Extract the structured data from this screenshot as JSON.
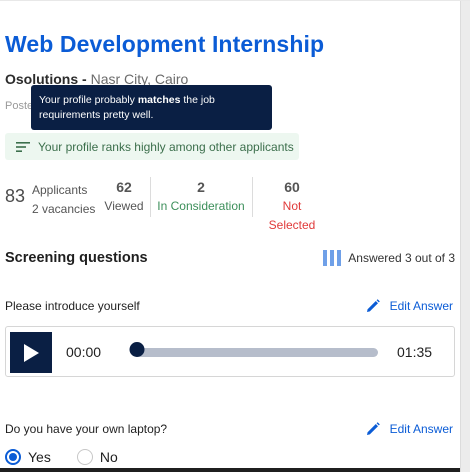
{
  "job": {
    "title": "Web Development Internship",
    "company": "Osolutions",
    "separator": " - ",
    "location": "Nasr City, Cairo",
    "posted_prefix": "Poste"
  },
  "tooltip": {
    "text_before": "Your profile probably ",
    "text_bold": "matches",
    "text_after": " the job requirements pretty well."
  },
  "rank_banner": {
    "icon": "sort-lines-icon",
    "text": "Your profile ranks highly among other applicants",
    "bg_color": "#edf7f0",
    "text_color": "#3c6f4c"
  },
  "stats": {
    "applicants_count": "83",
    "applicants_label": "Applicants",
    "vacancies_label": "2 vacancies",
    "viewed": {
      "count": "62",
      "label": "Viewed",
      "color": "#555555"
    },
    "in_consideration": {
      "count": "2",
      "label": "In Consideration",
      "color": "#3c8f5a"
    },
    "not_selected": {
      "count": "60",
      "label": "Not Selected",
      "color": "#e03a3a"
    }
  },
  "screening": {
    "title": "Screening questions",
    "answered_text": "Answered 3 out of 3",
    "answered_icon": "progress-bars-icon",
    "edit_label": "Edit Answer",
    "questions": [
      {
        "text": "Please introduce yourself",
        "type": "audio",
        "audio": {
          "current_time": "00:00",
          "duration": "01:35",
          "progress": 0
        }
      },
      {
        "text": "Do you have your own laptop?",
        "type": "radio",
        "options": [
          "Yes",
          "No"
        ],
        "selected": "Yes"
      }
    ]
  },
  "colors": {
    "accent": "#0b5cd6",
    "navy": "#0a1f44"
  }
}
